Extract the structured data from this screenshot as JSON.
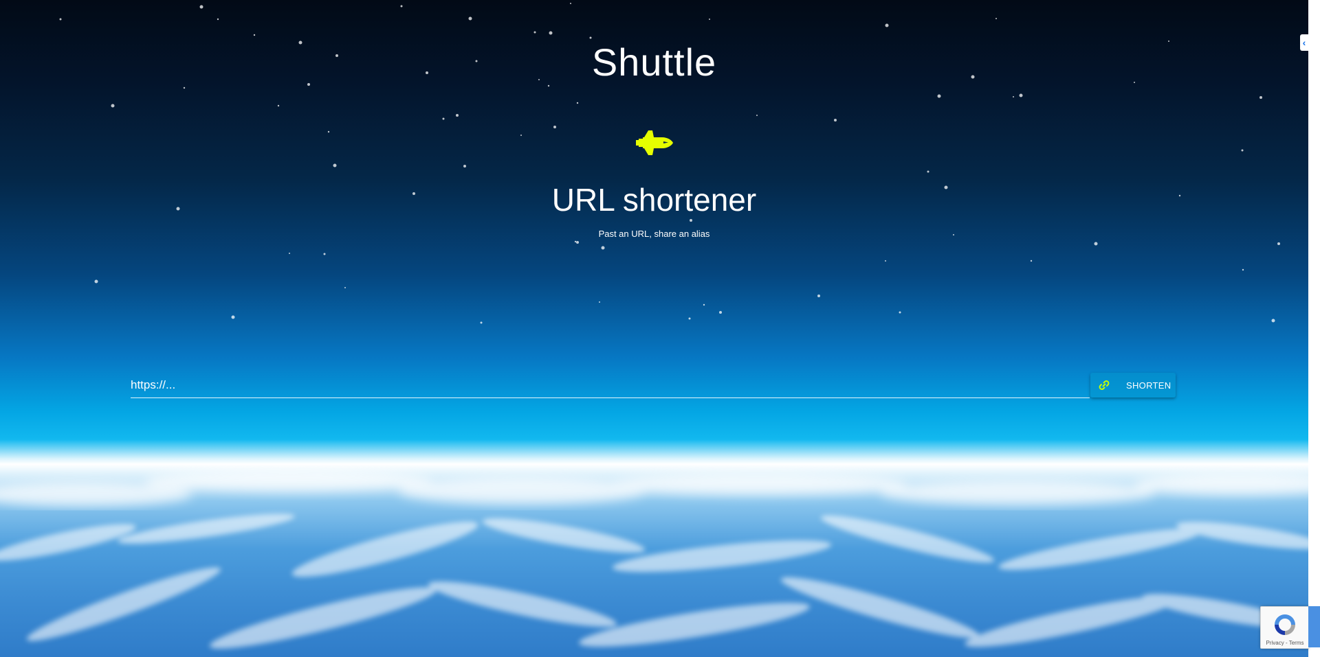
{
  "header": {
    "title": "Shuttle",
    "logo_icon": "space-shuttle-icon",
    "logo_color": "#e6ff00"
  },
  "hero": {
    "subtitle": "URL shortener",
    "tagline": "Past an URL, share an alias"
  },
  "form": {
    "url_placeholder": "https://...",
    "url_value": "",
    "shorten_label": "SHORTEN",
    "button_icon": "link-icon",
    "accent_color": "#c6ff00"
  },
  "recaptcha": {
    "links": "Privacy - Terms"
  },
  "side_tab": {
    "icon": "chevron-left-icon",
    "glyph": "‹"
  }
}
